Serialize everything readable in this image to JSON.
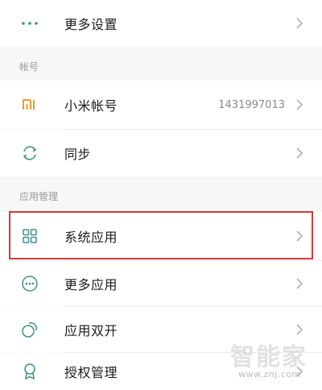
{
  "top_row": {
    "label": "更多设置"
  },
  "account_section": {
    "title": "帐号",
    "items": [
      {
        "label": "小米帐号",
        "value": "1431997013",
        "icon": "mi-logo-icon"
      },
      {
        "label": "同步",
        "value": "",
        "icon": "sync-icon"
      }
    ]
  },
  "app_section": {
    "title": "应用管理",
    "items": [
      {
        "label": "系统应用",
        "icon": "grid-apps-icon"
      },
      {
        "label": "更多应用",
        "icon": "more-apps-icon"
      },
      {
        "label": "应用双开",
        "icon": "dual-apps-icon"
      },
      {
        "label": "授权管理",
        "icon": "permission-badge-icon"
      }
    ]
  },
  "watermark": {
    "big": "智能家",
    "small": "www.znj.com"
  },
  "colors": {
    "icon_teal": "#3f8f8a",
    "mi_orange": "#f39a2b",
    "highlight_red": "#d43a3a",
    "chevron_gray": "#b0b0b0"
  }
}
